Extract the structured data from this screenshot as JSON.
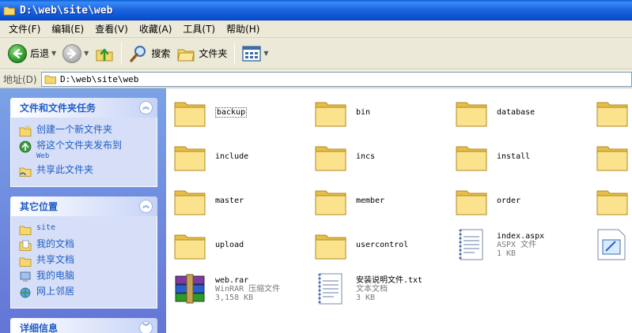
{
  "window": {
    "title": "D:\\web\\site\\web"
  },
  "menu": [
    "文件(F)",
    "编辑(E)",
    "查看(V)",
    "收藏(A)",
    "工具(T)",
    "帮助(H)"
  ],
  "toolbar": {
    "back": "后退",
    "search": "搜索",
    "folders": "文件夹"
  },
  "address": {
    "label": "地址(D)",
    "value": "D:\\web\\site\\web"
  },
  "panels": {
    "tasks": {
      "title": "文件和文件夹任务",
      "items": [
        {
          "label": "创建一个新文件夹",
          "icon": "new-folder-icon"
        },
        {
          "label": "将这个文件夹发布到",
          "label2": "Web",
          "icon": "publish-web-icon"
        },
        {
          "label": "共享此文件夹",
          "icon": "share-folder-icon"
        }
      ]
    },
    "places": {
      "title": "其它位置",
      "items": [
        {
          "label": "site",
          "icon": "folder-icon"
        },
        {
          "label": "我的文档",
          "icon": "my-documents-icon"
        },
        {
          "label": "共享文档",
          "icon": "shared-documents-icon"
        },
        {
          "label": "我的电脑",
          "icon": "my-computer-icon"
        },
        {
          "label": "网上邻居",
          "icon": "network-places-icon"
        }
      ]
    },
    "details": {
      "title": "详细信息"
    }
  },
  "files": {
    "folders": [
      "backup",
      "bin",
      "database",
      "include",
      "incs",
      "install",
      "master",
      "member",
      "order",
      "upload",
      "usercontrol"
    ],
    "index": {
      "name": "index.aspx",
      "type": "ASPX 文件",
      "size": "1 KB"
    },
    "rar": {
      "name": "web.rar",
      "type": "WinRAR 压缩文件",
      "size": "3,158 KB"
    },
    "txt": {
      "name": "安装说明文件.txt",
      "type": "文本文档",
      "size": "3 KB"
    }
  },
  "colors": {
    "titlebar": "#0a4fcf",
    "taskpane": "#6f8fe0",
    "link": "#215dc6",
    "folder": "#f5d76e"
  }
}
